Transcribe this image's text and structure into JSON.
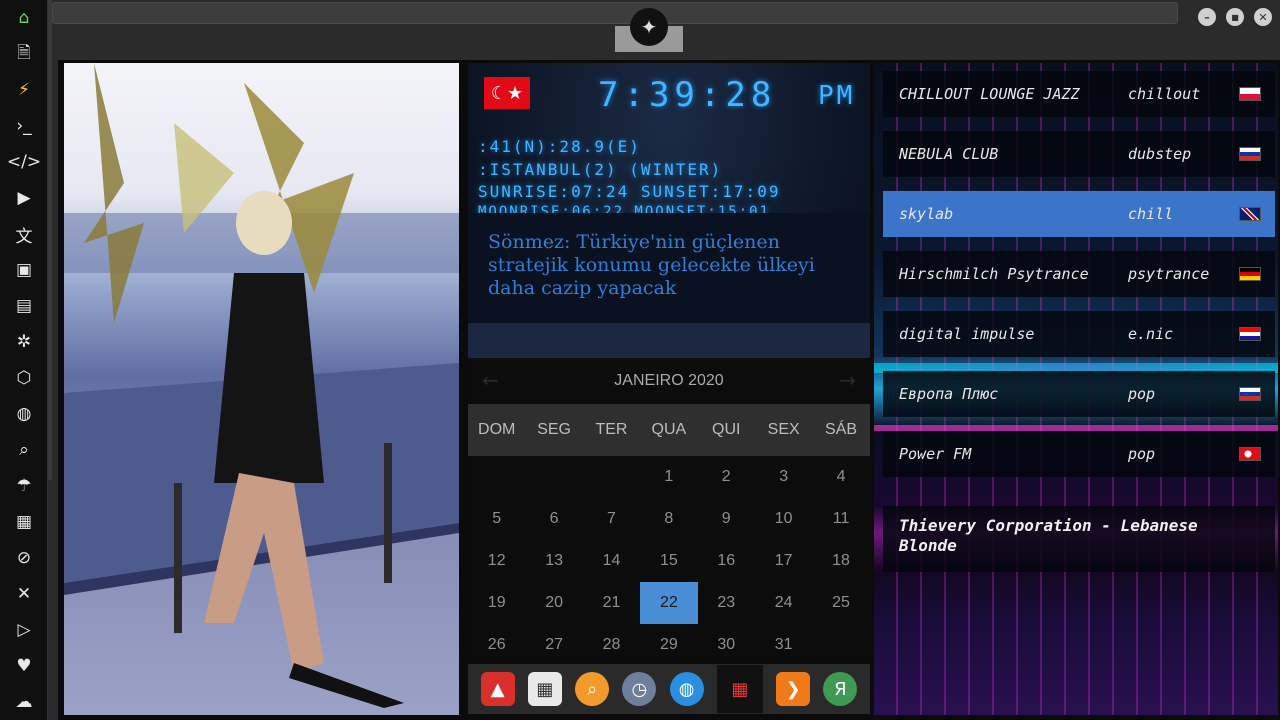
{
  "sidebar": {
    "icons": [
      "home-icon",
      "document-icon",
      "lightning-icon",
      "terminal-icon",
      "code-icon",
      "play-icon",
      "translate-icon",
      "image-icon",
      "news-icon",
      "settings-wheel-icon",
      "dice-icon",
      "globe-icon",
      "search-icon",
      "umbrella-icon",
      "contact-icon",
      "link-icon",
      "fullscreen-icon",
      "youtube-icon",
      "heart-icon",
      "cloud-icon"
    ],
    "glyphs": [
      "⌂",
      "🗎",
      "⚡",
      "›_",
      "</>",
      "▶",
      "文",
      "▣",
      "▤",
      "✲",
      "⬡",
      "◍",
      "⌕",
      "☂",
      "▦",
      "⊘",
      "✕",
      "▷",
      "♥",
      "☁"
    ]
  },
  "topbar": {
    "logo_glyph": "✦",
    "minimize": "–",
    "maximize": "■",
    "close": "✕"
  },
  "clock": {
    "time": "7:39:28",
    "ampm": "PM",
    "flag": "☾★",
    "coords": ":41(N):28.9(E)",
    "city": ":ISTANBUL(2) (WINTER)",
    "sun": "SUNRISE:07:24 SUNSET:17:09",
    "moon": "MOONRISE:06:22 MOONSET:15:01"
  },
  "news": {
    "headline": "Sönmez: Türkiye'nin güçlenen stratejik konumu gelecekte ülkeyi daha cazip yapacak"
  },
  "calendar": {
    "month": "JANEIRO 2020",
    "prev": "←",
    "next": "→",
    "weekdays": [
      "DOM",
      "SEG",
      "TER",
      "QUA",
      "QUI",
      "SEX",
      "SÁB"
    ],
    "weeks": [
      [
        "",
        "",
        "",
        "1",
        "2",
        "3",
        "4"
      ],
      [
        "5",
        "6",
        "7",
        "8",
        "9",
        "10",
        "11"
      ],
      [
        "12",
        "13",
        "14",
        "15",
        "16",
        "17",
        "18"
      ],
      [
        "19",
        "20",
        "21",
        "22",
        "23",
        "24",
        "25"
      ],
      [
        "26",
        "27",
        "28",
        "29",
        "30",
        "31",
        ""
      ]
    ],
    "today": "22"
  },
  "dock": {
    "icons": [
      "anydesk-icon",
      "news-app-icon",
      "search-app-icon",
      "clock-app-icon",
      "browser-globe-icon",
      "calendar-app-icon",
      "play-arrow-icon",
      "yandex-icon"
    ],
    "glyphs": [
      "▲",
      "▦",
      "⌕",
      "◷",
      "◍",
      "▦",
      "❯",
      "Я"
    ],
    "colors": [
      "#d9302b",
      "#e9e9e9",
      "#f39a2a",
      "#6e7f99",
      "#2a8fe0",
      "#e03a3a",
      "#f07a1a",
      "#3f9a54"
    ]
  },
  "radio": {
    "stations": [
      {
        "name": "CHILLOUT LOUNGE JAZZ",
        "genre": "chillout",
        "flag": "poland"
      },
      {
        "name": "NEBULA CLUB",
        "genre": "dubstep",
        "flag": "russia"
      },
      {
        "name": "skylab",
        "genre": "chill",
        "flag": "uk"
      },
      {
        "name": "Hirschmilch Psytrance",
        "genre": "psytrance",
        "flag": "germany"
      },
      {
        "name": "digital impulse",
        "genre": "e.nic",
        "flag": "croatia"
      },
      {
        "name": "Европа Плюс",
        "genre": "pop",
        "flag": "russia"
      },
      {
        "name": "Power FM",
        "genre": "pop",
        "flag": "turkey"
      }
    ],
    "selected_index": 2,
    "now_playing": "Thievery Corporation - Lebanese Blonde"
  },
  "colors": {
    "accent": "#4a8fd6",
    "digital": "#3fb6ff",
    "selected_station": "#3b74c8"
  }
}
